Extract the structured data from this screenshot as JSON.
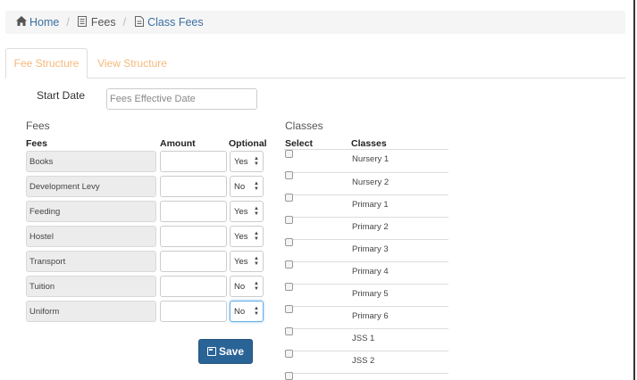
{
  "breadcrumb": [
    {
      "label": "Home",
      "icon": "home-icon",
      "link": true
    },
    {
      "label": "Fees",
      "icon": "document-icon",
      "link": false
    },
    {
      "label": "Class Fees",
      "icon": "document-icon",
      "link": true
    }
  ],
  "tabs": [
    {
      "label": "Fee Structure",
      "active": true
    },
    {
      "label": "View Structure",
      "active": false
    }
  ],
  "start_date": {
    "label": "Start Date",
    "placeholder": "Fees Effective Date",
    "value": ""
  },
  "fees": {
    "title": "Fees",
    "headers": {
      "fee": "Fees",
      "amount": "Amount",
      "optional": "Optional"
    },
    "rows": [
      {
        "name": "Books",
        "amount": "",
        "optional": "Yes"
      },
      {
        "name": "Development Levy",
        "amount": "",
        "optional": "No"
      },
      {
        "name": "Feeding",
        "amount": "",
        "optional": "Yes"
      },
      {
        "name": "Hostel",
        "amount": "",
        "optional": "Yes"
      },
      {
        "name": "Transport",
        "amount": "",
        "optional": "Yes"
      },
      {
        "name": "Tuition",
        "amount": "",
        "optional": "No"
      },
      {
        "name": "Uniform",
        "amount": "",
        "optional": "No"
      }
    ]
  },
  "save_label": "Save",
  "classes": {
    "title": "Classes",
    "headers": {
      "select": "Select",
      "classes": "Classes"
    },
    "rows": [
      {
        "name": "Nursery 1",
        "checked": false
      },
      {
        "name": "Nursery 2",
        "checked": false
      },
      {
        "name": "Primary 1",
        "checked": false
      },
      {
        "name": "Primary 2",
        "checked": false
      },
      {
        "name": "Primary 3",
        "checked": false
      },
      {
        "name": "Primary 4",
        "checked": false
      },
      {
        "name": "Primary 5",
        "checked": false
      },
      {
        "name": "Primary 6",
        "checked": false
      },
      {
        "name": "JSS 1",
        "checked": false
      },
      {
        "name": "JSS 2",
        "checked": false
      },
      {
        "name": "",
        "checked": false
      }
    ]
  },
  "colors": {
    "accent": "#f4b97a",
    "link": "#3a6fa3",
    "button": "#2a6496"
  }
}
